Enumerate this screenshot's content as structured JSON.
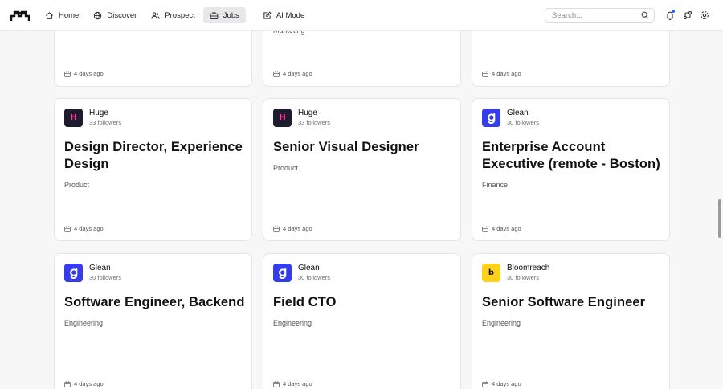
{
  "nav": {
    "items": [
      {
        "label": "Home",
        "icon": "home-icon"
      },
      {
        "label": "Discover",
        "icon": "globe-icon"
      },
      {
        "label": "Prospect",
        "icon": "users-icon"
      },
      {
        "label": "Jobs",
        "icon": "briefcase-icon",
        "active": true
      },
      {
        "label": "AI Mode",
        "icon": "edit-icon"
      }
    ],
    "search_placeholder": "Search..."
  },
  "partial_row": {
    "middle_dept": "Marketing",
    "posted": [
      "4 days ago",
      "4 days ago",
      "4 days ago"
    ]
  },
  "jobs": [
    {
      "company": "Huge",
      "followers": "33 followers",
      "logo_letter": "H",
      "title": "Design Director, Experience Design",
      "dept": "Product",
      "posted": "4 days ago"
    },
    {
      "company": "Huge",
      "followers": "33 followers",
      "logo_letter": "H",
      "title": "Senior Visual Designer",
      "dept": "Product",
      "posted": "4 days ago"
    },
    {
      "company": "Glean",
      "followers": "30 followers",
      "logo_letter": "g",
      "title": "Enterprise Account Executive (remote - Boston)",
      "dept": "Finance",
      "posted": "4 days ago"
    },
    {
      "company": "Glean",
      "followers": "30 followers",
      "logo_letter": "g",
      "title": "Software Engineer, Backend",
      "dept": "Engineering",
      "posted": "4 days ago"
    },
    {
      "company": "Glean",
      "followers": "30 followers",
      "logo_letter": "g",
      "title": "Field CTO",
      "dept": "Engineering",
      "posted": "4 days ago"
    },
    {
      "company": "Bloomreach",
      "followers": "30 followers",
      "logo_letter": "b",
      "title": "Senior Software Engineer",
      "dept": "Engineering",
      "posted": "4 days ago"
    }
  ],
  "colors": {
    "huge_logo_bg": "#1e1b2e",
    "huge_logo_fg": "#ff3f9a",
    "glean_logo_bg": "#343ced",
    "bloomreach_logo_bg": "#ffd21a",
    "active_nav_bg": "#e8e8ea",
    "notification_dot": "#2563eb"
  }
}
